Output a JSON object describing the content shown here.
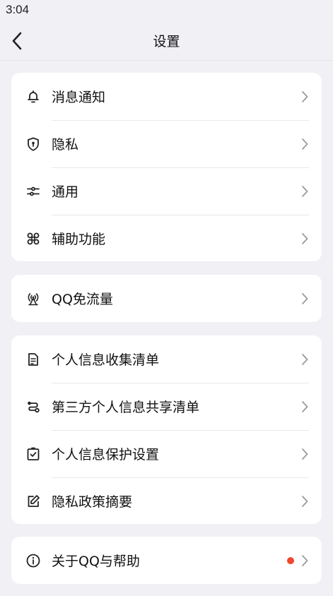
{
  "status_bar": {
    "time": "3:04"
  },
  "nav": {
    "title": "设置"
  },
  "colors": {
    "background": "#f0f0f5",
    "card": "#ffffff",
    "text": "#111111",
    "chevron": "#9a9aa0",
    "badge": "#f0472b"
  },
  "groups": [
    {
      "items": [
        {
          "label": "消息通知",
          "icon": "bell-icon"
        },
        {
          "label": "隐私",
          "icon": "shield-icon"
        },
        {
          "label": "通用",
          "icon": "sliders-icon"
        },
        {
          "label": "辅助功能",
          "icon": "command-icon"
        }
      ]
    },
    {
      "items": [
        {
          "label": "QQ免流量",
          "icon": "signal-tower-icon"
        }
      ]
    },
    {
      "items": [
        {
          "label": "个人信息收集清单",
          "icon": "document-list-icon"
        },
        {
          "label": "第三方个人信息共享清单",
          "icon": "share-flow-icon"
        },
        {
          "label": "个人信息保护设置",
          "icon": "checkbox-icon"
        },
        {
          "label": "隐私政策摘要",
          "icon": "edit-icon"
        }
      ]
    },
    {
      "items": [
        {
          "label": "关于QQ与帮助",
          "icon": "info-icon",
          "badge": "red-dot"
        }
      ]
    }
  ]
}
